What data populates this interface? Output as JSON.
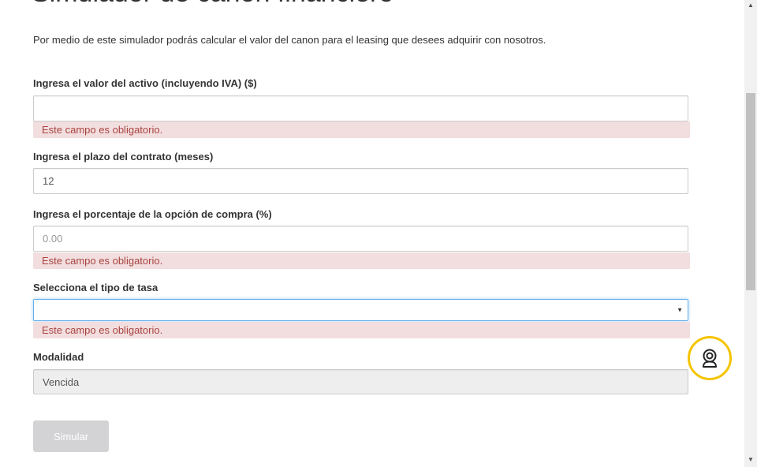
{
  "page": {
    "title": "Simulador de canon financiero",
    "intro": "Por medio de este simulador podrás calcular el valor del canon para el leasing que desees adquirir con nosotros."
  },
  "form": {
    "valor_activo": {
      "label": "Ingresa el valor del activo (incluyendo IVA) ($)",
      "value": "",
      "error": "Este campo es obligatorio."
    },
    "plazo": {
      "label": "Ingresa el plazo del contrato (meses)",
      "value": "12"
    },
    "opcion_compra": {
      "label": "Ingresa el porcentaje de la opción de compra (%)",
      "placeholder": "0.00",
      "error": "Este campo es obligatorio."
    },
    "tipo_tasa": {
      "label": "Selecciona el tipo de tasa",
      "selected": "",
      "error": "Este campo es obligatorio."
    },
    "modalidad": {
      "label": "Modalidad",
      "value": "Vencida"
    },
    "submit_label": "Simular"
  },
  "icons": {
    "chat": "chat-support-icon",
    "select_caret": "caret-down-icon",
    "scroll_up": "scroll-up-arrow-icon",
    "scroll_down": "scroll-down-arrow-icon"
  },
  "colors": {
    "error_bg": "#f2dede",
    "error_text": "#a94442",
    "chat_ring": "#f5c400",
    "button_disabled": "#d3d3d5"
  }
}
